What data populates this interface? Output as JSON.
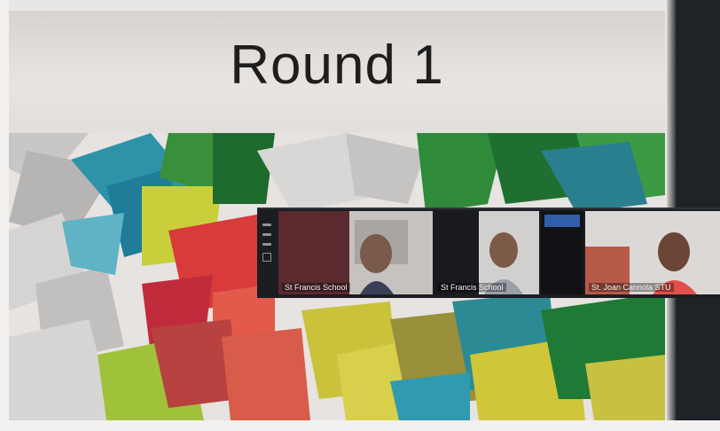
{
  "slide": {
    "title": "Round 1"
  },
  "meeting": {
    "participants": [
      {
        "name": "St Francis School"
      },
      {
        "name": "St Francis School"
      },
      {
        "name": "St. Joan Cannola STU"
      }
    ]
  },
  "colors": {
    "title_band": "#e3dfdb",
    "title_text": "#1e1e1e",
    "strip_bg": "#1b1d22",
    "bezel": "#1f2226"
  }
}
